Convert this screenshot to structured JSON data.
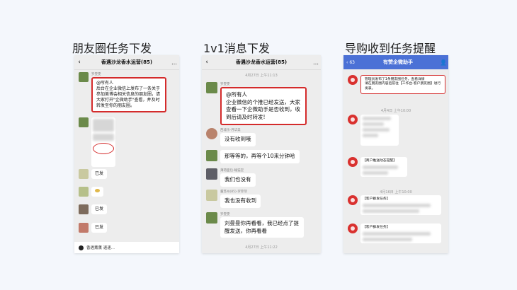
{
  "headings": {
    "moments": "朋友圈任务下发",
    "one_to_one": "1v1消息下发",
    "guide": "导购收到任务提醒"
  },
  "phone1": {
    "title": "香遇沙龙香水运营(85)",
    "names": {
      "m1": "罗雯雯",
      "m2": "",
      "m3": "",
      "m4": "",
      "m5": ""
    },
    "announcement": "@所有人\n后台在企业微信上发布了一条关于参加美博会相关信息的朋友圈，请大家打开\"企微助手\"查看，并及时转发至你的朋友圈。",
    "replies": [
      "已发",
      "已发",
      "已发"
    ],
    "bottom": "香遇薰薰 速速..."
  },
  "phone2": {
    "title": "香遇沙龙香水运营(85)",
    "time_top": "4月27日 上午11:13",
    "names": {
      "m1": "罗雯雯",
      "m2": "西墟乐-月华美",
      "m3": "",
      "m4": "薄荷面包-睡猫堂",
      "m5": "董苏州(85)-罗菲菲",
      "m6": "罗雯雯"
    },
    "big_msg": "@所有人\n企业微信的个推已经发送，大家查看一下企微助手是否收到，收到后请及时转发!",
    "replies": [
      "没有收到哦",
      "那等等的，再等个10来分钟哈",
      "我们也没有",
      "我也没有收到"
    ],
    "final_msg": "刘曼曼你再看看，我已经点了提醒发送，你再看看",
    "time_bottom": "4月27日 上午11:22"
  },
  "phone3": {
    "badge": "63",
    "title": "有赞企微助手",
    "first_msg": "管理员发布了1条朋友圈任务，查看详情\n请在朋友圈内容后前往【工作台-客户朋友圈】进行发表。",
    "time1": "4月4日 上午10:00",
    "time2": "4月16日 上午10:00",
    "notice": "【商户推送动态提醒】",
    "task_title": "【客户群发任务】"
  },
  "colors": {
    "red": "#d42b2b",
    "blue_bar": "#4b71d6",
    "chat_bg": "#ededed"
  }
}
